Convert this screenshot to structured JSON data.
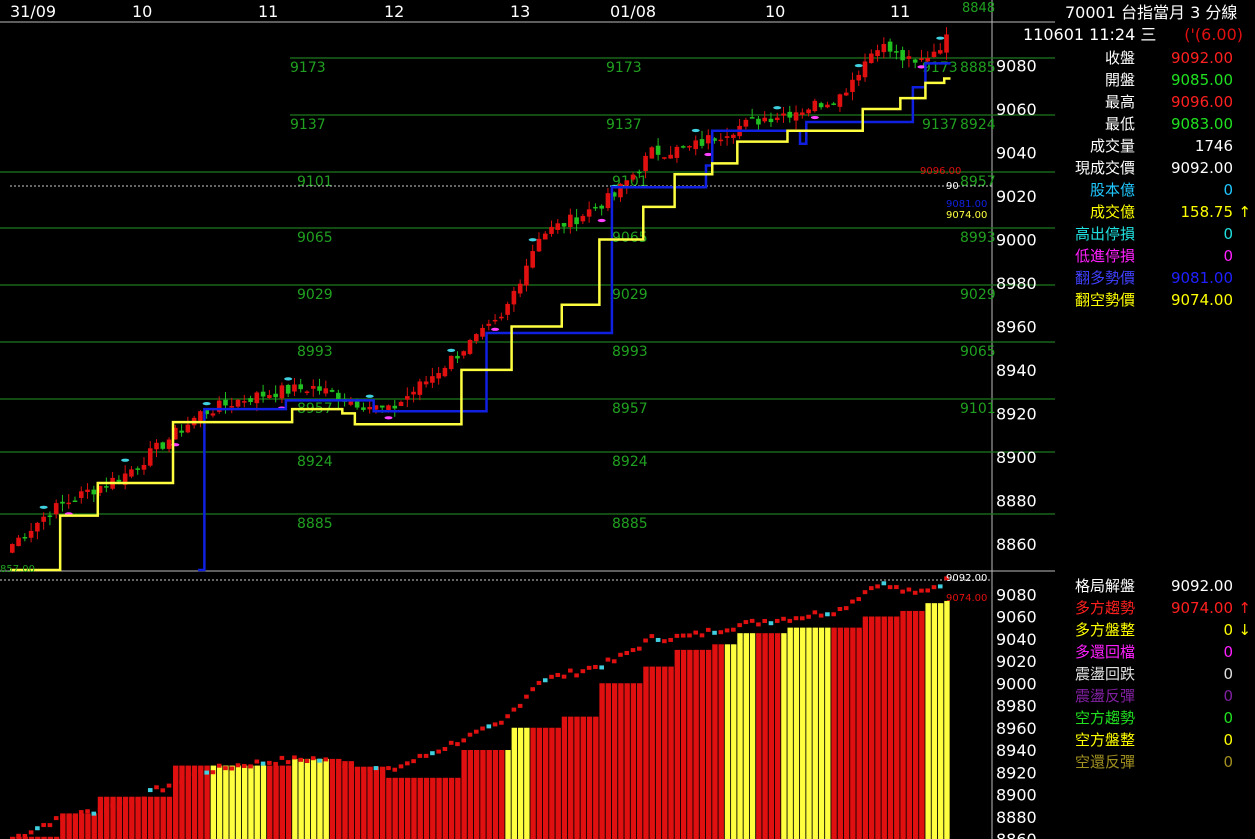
{
  "header": {
    "code_title": "70001 台指當月 3 分線",
    "datetime": "110601 11:24 三",
    "change": "('(6.00)"
  },
  "x_axis_labels": [
    "31/09",
    "10",
    "11",
    "12",
    "13",
    "01/08",
    "10",
    "11"
  ],
  "top_axis_extra": "8848",
  "stats_top": [
    {
      "label": "收盤",
      "value": "9092.00",
      "label_color": "#ffffff",
      "value_color": "#ff2020",
      "arrow": ""
    },
    {
      "label": "開盤",
      "value": "9085.00",
      "label_color": "#ffffff",
      "value_color": "#20e020",
      "arrow": ""
    },
    {
      "label": "最高",
      "value": "9096.00",
      "label_color": "#ffffff",
      "value_color": "#ff2020",
      "arrow": ""
    },
    {
      "label": "最低",
      "value": "9083.00",
      "label_color": "#ffffff",
      "value_color": "#20e020",
      "arrow": ""
    },
    {
      "label": "成交量",
      "value": "1746",
      "label_color": "#ffffff",
      "value_color": "#ffffff",
      "arrow": ""
    },
    {
      "label": "現成交價",
      "value": "9092.00",
      "label_color": "#ffffff",
      "value_color": "#ffffff",
      "arrow": ""
    },
    {
      "label": "股本億",
      "value": "0",
      "label_color": "#20c8ff",
      "value_color": "#20c8ff",
      "arrow": ""
    },
    {
      "label": "成交億",
      "value": "158.75",
      "label_color": "#ffff00",
      "value_color": "#ffff00",
      "arrow": "↑"
    },
    {
      "label": "高出停損",
      "value": "0",
      "label_color": "#20e0e0",
      "value_color": "#20e0e0",
      "arrow": ""
    },
    {
      "label": "低進停損",
      "value": "0",
      "label_color": "#ff20ff",
      "value_color": "#ff20ff",
      "arrow": ""
    },
    {
      "label": "翻多勢價",
      "value": "9081.00",
      "label_color": "#4040ff",
      "value_color": "#2020ff",
      "arrow": ""
    },
    {
      "label": "翻空勢價",
      "value": "9074.00",
      "label_color": "#ffff00",
      "value_color": "#ffff00",
      "arrow": ""
    }
  ],
  "stats_bottom": [
    {
      "label": "格局解盤",
      "value": "9092.00",
      "label_color": "#ffffff",
      "value_color": "#ffffff",
      "arrow": ""
    },
    {
      "label": "多方趨勢",
      "value": "9074.00",
      "label_color": "#ff2020",
      "value_color": "#ff2020",
      "arrow": "↑"
    },
    {
      "label": "多方盤整",
      "value": "0",
      "label_color": "#ffff00",
      "value_color": "#ffff00",
      "arrow": "↓"
    },
    {
      "label": "多還回檔",
      "value": "0",
      "label_color": "#ff20ff",
      "value_color": "#ff20ff",
      "arrow": ""
    },
    {
      "label": "震盪回跌",
      "value": "0",
      "label_color": "#e0e0e0",
      "value_color": "#e0e0e0",
      "arrow": ""
    },
    {
      "label": "震盪反彈",
      "value": "0",
      "label_color": "#8020a0",
      "value_color": "#8020a0",
      "arrow": ""
    },
    {
      "label": "空方趨勢",
      "value": "0",
      "label_color": "#20e020",
      "value_color": "#20e020",
      "arrow": ""
    },
    {
      "label": "空方盤整",
      "value": "0",
      "label_color": "#ffff00",
      "value_color": "#ffff00",
      "arrow": ""
    },
    {
      "label": "空還反彈",
      "value": "0",
      "label_color": "#a09020",
      "value_color": "#a09020",
      "arrow": ""
    }
  ],
  "colors": {
    "up": "#e01010",
    "down": "#20c020",
    "yellow": "#ffff40",
    "blue": "#1020e0",
    "cyan": "#40d0e0",
    "magenta": "#ff40ff",
    "grid": "#1c7a1c",
    "level_text": "#20a020",
    "axis_text": "#ffffff"
  },
  "chart_data": [
    {
      "type": "candlestick",
      "title": "70001 台指當月 3 分線",
      "ylim": [
        8848,
        9100
      ],
      "y_ticks": [
        8860,
        8880,
        8900,
        8920,
        8940,
        8960,
        8980,
        9000,
        9020,
        9040,
        9060,
        9080
      ],
      "close_marker": "9092.00",
      "price_tags": [
        "9096.00",
        "9081.00",
        "9074.00",
        "90",
        "857.00"
      ],
      "level_lines": [
        {
          "value": 9173,
          "labels": [
            "9173",
            "9173",
            "9173"
          ],
          "right_label": "8885"
        },
        {
          "value": 9137,
          "labels": [
            "9137",
            "9137",
            "9137"
          ],
          "right_label": "8924"
        },
        {
          "value": 9101,
          "labels": [
            "9101",
            "9101"
          ],
          "right_label": "8957"
        },
        {
          "value": 9065,
          "labels": [
            "9065",
            "9065"
          ],
          "right_label": "8993"
        },
        {
          "value": 9029,
          "labels": [
            "9029",
            "9029"
          ],
          "right_label": "9029"
        },
        {
          "value": 8993,
          "labels": [
            "8993",
            "8993"
          ],
          "right_label": "9065"
        },
        {
          "value": 8957,
          "labels": [
            "8957",
            "8957"
          ],
          "right_label": "9101"
        },
        {
          "value": 8924,
          "labels": [
            "8924",
            "8924"
          ],
          "right_label": ""
        },
        {
          "value": 8885,
          "labels": [
            "8885",
            "8885"
          ],
          "right_label": ""
        }
      ],
      "candles": {
        "count": 150,
        "close_anchors": [
          [
            0,
            8860
          ],
          [
            6,
            8875
          ],
          [
            12,
            8884
          ],
          [
            18,
            8892
          ],
          [
            24,
            8906
          ],
          [
            30,
            8920
          ],
          [
            36,
            8926
          ],
          [
            42,
            8930
          ],
          [
            48,
            8932
          ],
          [
            54,
            8926
          ],
          [
            60,
            8921
          ],
          [
            66,
            8935
          ],
          [
            72,
            8950
          ],
          [
            78,
            8963
          ],
          [
            84,
            9002
          ],
          [
            90,
            9010
          ],
          [
            96,
            9020
          ],
          [
            102,
            9040
          ],
          [
            108,
            9042
          ],
          [
            114,
            9050
          ],
          [
            120,
            9056
          ],
          [
            126,
            9060
          ],
          [
            132,
            9066
          ],
          [
            138,
            9090
          ],
          [
            144,
            9080
          ],
          [
            149,
            9092
          ]
        ]
      },
      "support_line": {
        "color": "yellow",
        "steps": [
          [
            0,
            8848
          ],
          [
            8,
            8873
          ],
          [
            14,
            8888
          ],
          [
            26,
            8916
          ],
          [
            45,
            8922
          ],
          [
            53,
            8920
          ],
          [
            55,
            8915
          ],
          [
            72,
            8940
          ],
          [
            80,
            8960
          ],
          [
            88,
            8970
          ],
          [
            94,
            9000
          ],
          [
            101,
            9015
          ],
          [
            106,
            9030
          ],
          [
            112,
            9035
          ],
          [
            116,
            9045
          ],
          [
            124,
            9050
          ],
          [
            136,
            9060
          ],
          [
            142,
            9065
          ],
          [
            146,
            9072
          ],
          [
            149,
            9074
          ]
        ]
      },
      "resistance_line": {
        "color": "blue",
        "steps": [
          [
            30,
            8848
          ],
          [
            31,
            8922
          ],
          [
            44,
            8926
          ],
          [
            58,
            8921
          ],
          [
            76,
            8957
          ],
          [
            95,
            8957
          ],
          [
            96,
            9024
          ],
          [
            111,
            9034
          ],
          [
            112,
            9050
          ],
          [
            126,
            9044
          ],
          [
            127,
            9054
          ],
          [
            144,
            9070
          ],
          [
            146,
            9081
          ],
          [
            149,
            9081
          ]
        ]
      }
    },
    {
      "type": "bar",
      "title": "",
      "ylim": [
        8860,
        9100
      ],
      "y_ticks": [
        8860,
        8880,
        8900,
        8920,
        8940,
        8960,
        8980,
        9000,
        9020,
        9040,
        9060,
        9080
      ],
      "close_marker": "9092.00",
      "price_tags": [
        "9092.00",
        "9074.00"
      ],
      "note": "Trend bars follow the yellow support level; color red = 多方趨勢, yellow = 多方盤整",
      "yellow_bar_ranges": [
        [
          32,
          40
        ],
        [
          45,
          50
        ],
        [
          79,
          82
        ],
        [
          114,
          118
        ],
        [
          123,
          130
        ],
        [
          146,
          149
        ]
      ]
    }
  ]
}
